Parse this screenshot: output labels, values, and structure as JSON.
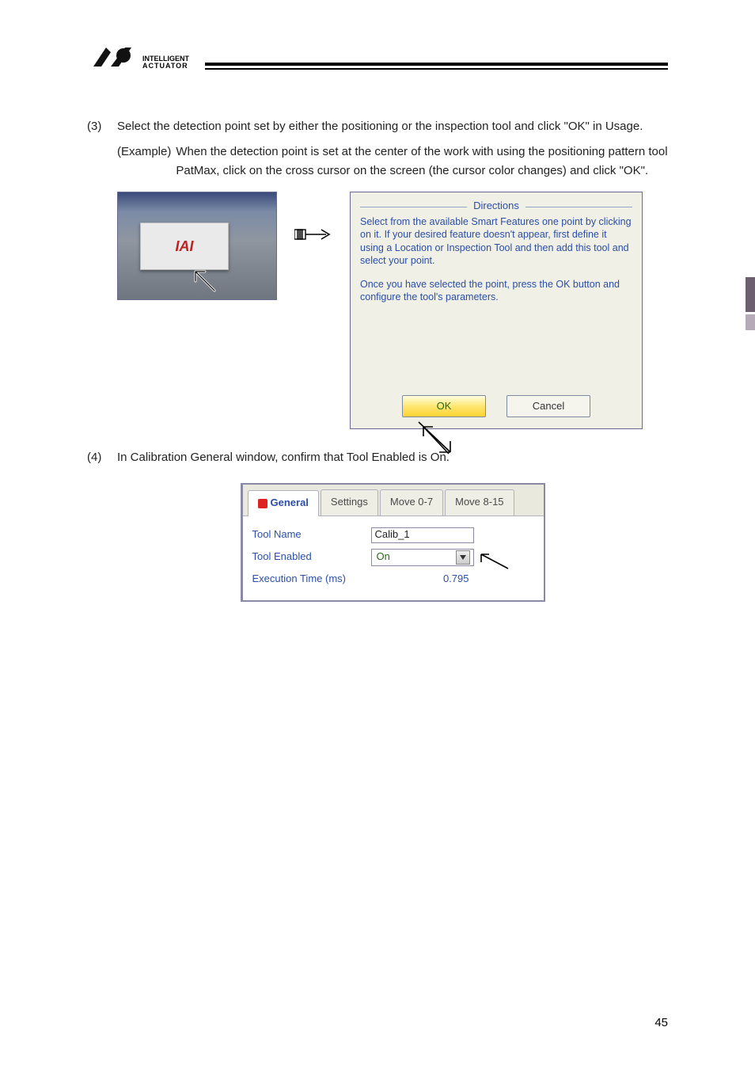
{
  "brand": {
    "name": "INTELLIGENT",
    "sub": "ACTUATOR"
  },
  "step3": {
    "num": "(3)",
    "text": "Select the detection point set by either the positioning or the inspection tool and click \"OK\" in Usage.",
    "exampleLabel": "(Example)",
    "exampleText1": "When the detection point is set at the center of the work with using the positioning pattern tool PatMax, click on the cross cursor on the screen (the cursor color changes) and click \"OK\"."
  },
  "camera": {
    "sticker": "IAI"
  },
  "directions": {
    "title": "Directions",
    "para1": "Select from the available Smart Features one point by clicking on it. If your desired feature doesn't appear, first define it using a Location or Inspection Tool and then add this tool and select your point.",
    "para2": "Once you have selected the point, press the OK button and configure the tool's parameters.",
    "ok": "OK",
    "cancel": "Cancel"
  },
  "step4": {
    "num": "(4)",
    "text": "In Calibration General window, confirm that Tool Enabled is On."
  },
  "calib": {
    "tabs": [
      "General",
      "Settings",
      "Move 0-7",
      "Move 8-15"
    ],
    "rows": {
      "toolNameLabel": "Tool Name",
      "toolNameValue": "Calib_1",
      "toolEnabledLabel": "Tool Enabled",
      "toolEnabledValue": "On",
      "execLabel": "Execution Time (ms)",
      "execValue": "0.795"
    }
  },
  "pageNumber": "45"
}
